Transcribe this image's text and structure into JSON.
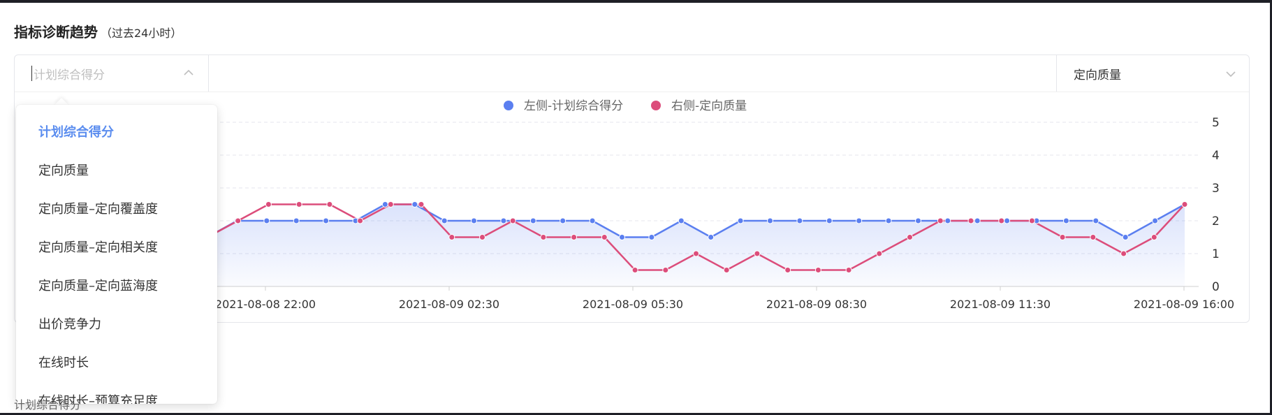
{
  "header": {
    "title": "指标诊断趋势",
    "subtitle": "（过去24小时）"
  },
  "left_select": {
    "placeholder": "计划综合得分",
    "icon": "chevron-up-icon"
  },
  "right_select": {
    "value": "定向质量",
    "icon": "chevron-down-icon"
  },
  "dropdown": {
    "items": [
      {
        "label": "计划综合得分",
        "selected": true
      },
      {
        "label": "定向质量",
        "selected": false
      },
      {
        "label": "定向质量–定向覆盖度",
        "selected": false
      },
      {
        "label": "定向质量–定向相关度",
        "selected": false
      },
      {
        "label": "定向质量–定向蓝海度",
        "selected": false
      },
      {
        "label": "出价竞争力",
        "selected": false
      },
      {
        "label": "在线时长",
        "selected": false
      },
      {
        "label": "在线时长–预算充足度",
        "selected": false
      }
    ]
  },
  "colors": {
    "left_series": "#5b7ff0",
    "right_series": "#dc4d7b",
    "selected_item": "#5b8def"
  },
  "chart_data": {
    "type": "line",
    "x_ticks": [
      "2021-08-08 22:00",
      "2021-08-09 02:30",
      "2021-08-09 05:30",
      "2021-08-09 08:30",
      "2021-08-09 11:30",
      "2021-08-09 16:00"
    ],
    "y_ticks_right": [
      "0",
      "1",
      "2",
      "3",
      "4",
      "5"
    ],
    "ylim": [
      0,
      5
    ],
    "grid": "horizontal dashed",
    "legend_position": "top-center",
    "series": [
      {
        "name": "左侧-计划综合得分",
        "area_fill": true,
        "values": [
          1.5,
          2,
          2,
          2,
          2,
          2,
          2.5,
          2.5,
          2,
          2,
          2,
          2,
          2,
          2,
          1.5,
          1.5,
          2,
          1.5,
          2,
          2,
          2,
          2,
          2,
          2,
          2,
          2,
          2,
          2,
          2,
          2,
          2,
          1.5,
          2,
          2.5
        ]
      },
      {
        "name": "右侧-定向质量",
        "values": [
          1.5,
          2,
          2.5,
          2.5,
          2.5,
          2,
          2.5,
          2.5,
          1.5,
          1.5,
          2,
          1.5,
          1.5,
          1.5,
          0.5,
          0.5,
          1,
          0.5,
          1,
          0.5,
          0.5,
          0.5,
          1,
          1.5,
          2,
          2,
          2,
          2,
          1.5,
          1.5,
          1,
          1.5,
          2.5
        ]
      }
    ]
  },
  "clipped_text": "计划综合得分"
}
